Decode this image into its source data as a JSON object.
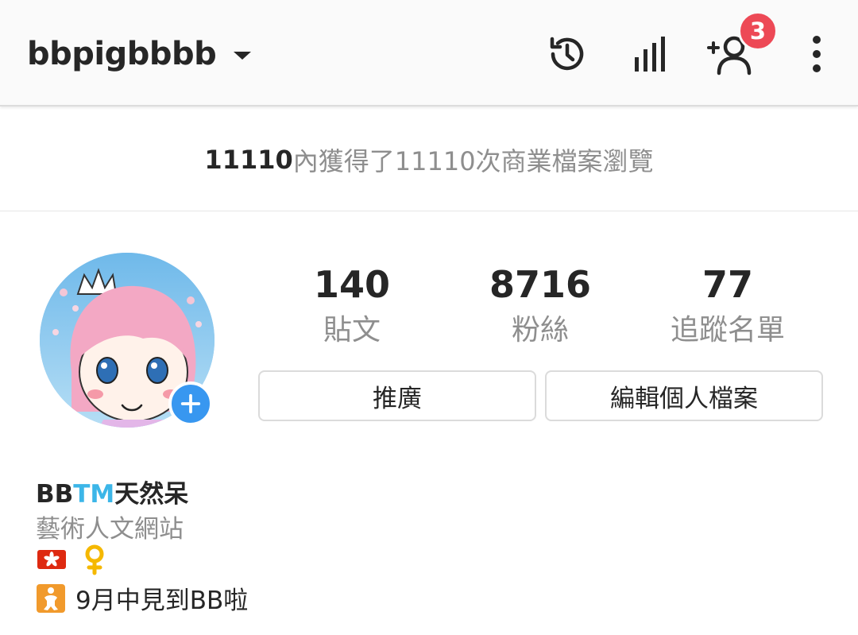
{
  "header": {
    "username": "bbpigbbbb",
    "notification_count": "3"
  },
  "insights_banner": {
    "count": "11110",
    "text": "內獲得了11110次商業檔案瀏覽"
  },
  "profile": {
    "stats": [
      {
        "value": "140",
        "label": "貼文"
      },
      {
        "value": "8716",
        "label": "粉絲"
      },
      {
        "value": "77",
        "label": "追蹤名單"
      }
    ],
    "promote_label": "推廣",
    "edit_profile_label": "編輯個人檔案"
  },
  "bio": {
    "name_prefix": "BB",
    "name_tm": "TM",
    "name_suffix": "天然呆",
    "category": "藝術人文網站",
    "emojis": [
      "hong-kong-flag",
      "female-sign"
    ],
    "line_text": "9月中見到BB啦"
  },
  "colors": {
    "badge": "#ed4956",
    "add_story": "#3897f0",
    "tm_accent": "#3cb6e8",
    "muted": "#8e8e8e"
  }
}
